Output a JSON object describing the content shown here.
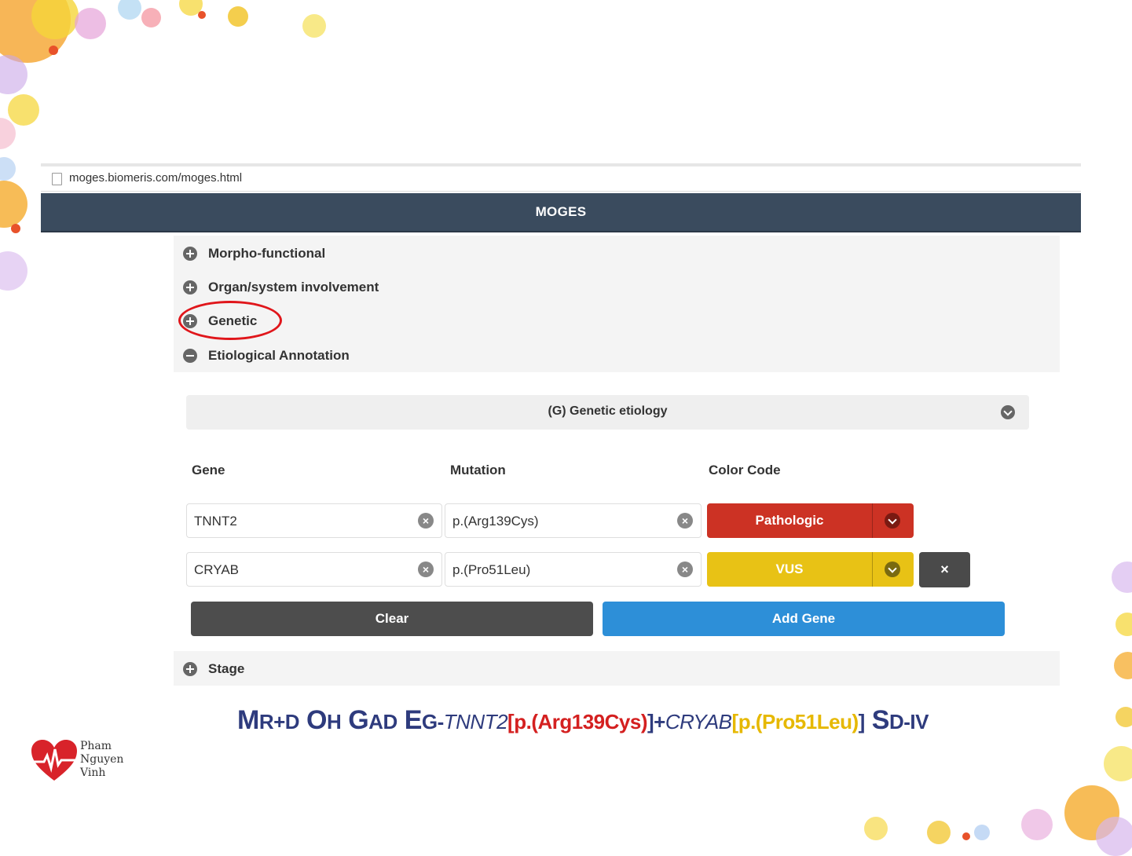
{
  "browser": {
    "url": "moges.biomeris.com/moges.html"
  },
  "app": {
    "title": "MOGES"
  },
  "accordion": {
    "items": [
      {
        "label": "Morpho-functional",
        "state": "collapsed"
      },
      {
        "label": "Organ/system involvement",
        "state": "collapsed"
      },
      {
        "label": "Genetic",
        "state": "collapsed"
      },
      {
        "label": "Etiological Annotation",
        "state": "expanded"
      }
    ]
  },
  "genetic_section": {
    "title": "(G) Genetic etiology",
    "columns": {
      "gene": "Gene",
      "mutation": "Mutation",
      "color_code": "Color Code"
    },
    "rows": [
      {
        "gene": "TNNT2",
        "mutation": "p.(Arg139Cys)",
        "color_code": "Pathologic",
        "color": "#cc3224"
      },
      {
        "gene": "CRYAB",
        "mutation": "p.(Pro51Leu)",
        "color_code": "VUS",
        "color": "#e8c215"
      }
    ],
    "remove_label": "×",
    "clear_label": "Clear",
    "add_label": "Add Gene"
  },
  "stage": {
    "label": "Stage"
  },
  "formula": {
    "m": "M",
    "m_sub": "R+D",
    "o": "O",
    "o_sub": "H",
    "g": "G",
    "g_sub": "AD",
    "e": "E",
    "e_sub": "G-",
    "gene1": "TNNT2",
    "bracket1_open": "[",
    "mut1": "p.(Arg139Cys)",
    "bracket1_close": "]+",
    "gene2": "CRYAB",
    "bracket2_open": "[",
    "mut2": "p.(Pro51Leu)",
    "bracket2_close": "]",
    "s": "S",
    "s_sub": "D-IV"
  },
  "logo": {
    "line1": "Pham",
    "line2": "Nguyen",
    "line3": "Vinh"
  },
  "colors": {
    "header": "#3a4b5e",
    "clear_button": "#4d4d4d",
    "add_button": "#2d8fd8",
    "highlight": "#e0161b",
    "formula": "#2e3b7d"
  }
}
